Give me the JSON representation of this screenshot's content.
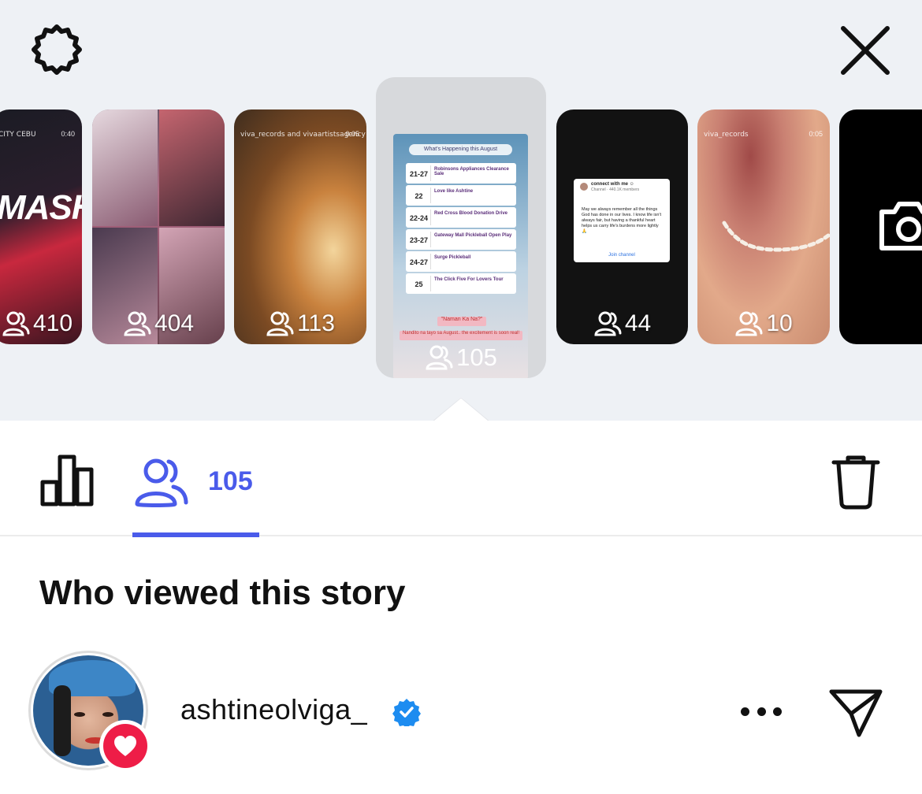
{
  "header": {
    "settings_icon": "gear-icon",
    "close_icon": "close-icon"
  },
  "stories": [
    {
      "viewers": "410",
      "tag": "CITY CEBU",
      "time": "0:40"
    },
    {
      "viewers": "404"
    },
    {
      "viewers": "113",
      "tag": "viva_records and vivaartistsagency",
      "time": "0:05"
    },
    {
      "viewers": "105",
      "selected": true,
      "poster_title": "What's Happening this August",
      "events": [
        {
          "date": "21-27",
          "title": "Robinsons Appliances Clearance Sale"
        },
        {
          "date": "22",
          "title": "Love like Ashtine"
        },
        {
          "date": "22-24",
          "title": "Red Cross Blood Donation Drive"
        },
        {
          "date": "23-27",
          "title": "Gateway Mall Pickleball Open Play"
        },
        {
          "date": "24-27",
          "title": "Surge Pickleball"
        },
        {
          "date": "25",
          "title": "The Click Five For Lovers Tour"
        }
      ],
      "pink_lines": [
        "\"Naman Ka Na?\"",
        "Nandito na tayo sa August.. the excitement is soon real!"
      ]
    },
    {
      "viewers": "44",
      "channel_title": "connect with me ☺",
      "channel_sub": "Channel · 440.1K members",
      "message": "May we always remember all the things God has done in our lives. I know life isn't always fair, but having a thankful heart helps us carry life's burdens more lightly 🙏",
      "join": "Join channel"
    },
    {
      "viewers": "10",
      "tag": "viva_records",
      "time": "0:05"
    },
    {
      "icon": "camera-icon"
    }
  ],
  "tabs": {
    "insights_icon": "bar-chart-icon",
    "viewers_icon": "viewers-icon",
    "viewers_count": "105",
    "delete_icon": "trash-icon"
  },
  "viewers_section": {
    "title": "Who viewed this story",
    "viewers": [
      {
        "username": "ashtineolviga_",
        "verified": true,
        "liked": true
      }
    ]
  },
  "colors": {
    "accent": "#4a5bea",
    "like": "#ee1d47",
    "verified": "#1d8cf0",
    "tray_bg": "#eef1f5"
  }
}
